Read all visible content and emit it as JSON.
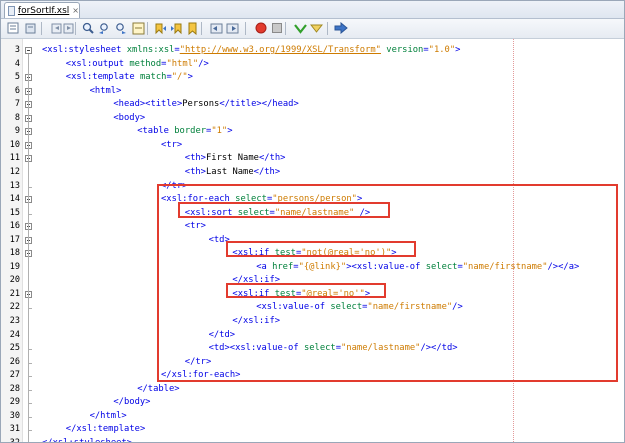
{
  "tab": {
    "title": "forSortIf.xsl",
    "close": "×"
  },
  "toolbar": {
    "buttons": [
      "source-view-icon",
      "history-icon",
      "back-icon",
      "forward-icon",
      "find-icon",
      "find-prev-icon",
      "find-next-icon",
      "toggle-highlight-icon",
      "prev-bookmark-icon",
      "next-bookmark-icon",
      "toggle-bookmark-icon",
      "shift-left-icon",
      "shift-right-icon",
      "record-macro-icon",
      "stop-macro-icon",
      "comment-icon",
      "uncomment-icon",
      "run-icon"
    ],
    "colors": {
      "record": "#e23b2e",
      "stop": "#8a8a8a",
      "check": "#33a02c",
      "arrow": "#3d74c6"
    }
  },
  "editor": {
    "highlight_color": "#e23b2e",
    "lines": [
      {
        "n": "3",
        "indent": 0,
        "segs": [
          [
            "pu",
            "<"
          ],
          [
            "ns",
            "xsl:stylesheet "
          ],
          [
            "at",
            "xmlns:xsl"
          ],
          [
            "pu",
            "="
          ],
          [
            "ul",
            "\"http://www.w3.org/1999/XSL/Transform\""
          ],
          [
            "tx",
            " "
          ],
          [
            "at",
            "version"
          ],
          [
            "pu",
            "="
          ],
          [
            "av",
            "\"1.0\""
          ],
          [
            "pu",
            ">"
          ]
        ]
      },
      {
        "n": "4",
        "indent": 1,
        "segs": [
          [
            "pu",
            "<"
          ],
          [
            "ns",
            "xsl:output "
          ],
          [
            "at",
            "method"
          ],
          [
            "pu",
            "="
          ],
          [
            "av",
            "\"html\""
          ],
          [
            "pu",
            "/>"
          ]
        ]
      },
      {
        "n": "5",
        "indent": 1,
        "segs": [
          [
            "pu",
            "<"
          ],
          [
            "ns",
            "xsl:template "
          ],
          [
            "at",
            "match"
          ],
          [
            "pu",
            "="
          ],
          [
            "av",
            "\"/\""
          ],
          [
            "pu",
            ">"
          ]
        ]
      },
      {
        "n": "6",
        "indent": 2,
        "segs": [
          [
            "pu",
            "<html>"
          ]
        ]
      },
      {
        "n": "7",
        "indent": 3,
        "segs": [
          [
            "pu",
            "<head><title>"
          ],
          [
            "tx",
            "Persons"
          ],
          [
            "pu",
            "</title></head>"
          ]
        ]
      },
      {
        "n": "8",
        "indent": 3,
        "segs": [
          [
            "pu",
            "<body>"
          ]
        ]
      },
      {
        "n": "9",
        "indent": 4,
        "segs": [
          [
            "pu",
            "<table "
          ],
          [
            "at",
            "border"
          ],
          [
            "pu",
            "="
          ],
          [
            "av",
            "\"1\""
          ],
          [
            "pu",
            ">"
          ]
        ]
      },
      {
        "n": "10",
        "indent": 5,
        "segs": [
          [
            "pu",
            "<tr>"
          ]
        ]
      },
      {
        "n": "11",
        "indent": 6,
        "segs": [
          [
            "pu",
            "<th>"
          ],
          [
            "tx",
            "First Name"
          ],
          [
            "pu",
            "</th>"
          ]
        ]
      },
      {
        "n": "12",
        "indent": 6,
        "segs": [
          [
            "pu",
            "<th>"
          ],
          [
            "tx",
            "Last Name"
          ],
          [
            "pu",
            "</th>"
          ]
        ]
      },
      {
        "n": "13",
        "indent": 5,
        "segs": [
          [
            "pu",
            "</tr>"
          ]
        ]
      },
      {
        "n": "14",
        "indent": 5,
        "segs": [
          [
            "pu",
            "<"
          ],
          [
            "ns",
            "xsl:for-each "
          ],
          [
            "at",
            "select"
          ],
          [
            "pu",
            "="
          ],
          [
            "av",
            "\"persons/person\""
          ],
          [
            "pu",
            ">"
          ]
        ]
      },
      {
        "n": "15",
        "indent": 6,
        "segs": [
          [
            "pu",
            "<"
          ],
          [
            "ns",
            "xsl:sort "
          ],
          [
            "at",
            "select"
          ],
          [
            "pu",
            "="
          ],
          [
            "av",
            "\"name/lastname\""
          ],
          [
            "tx",
            " "
          ],
          [
            "pu",
            "/>"
          ]
        ]
      },
      {
        "n": "16",
        "indent": 6,
        "segs": [
          [
            "pu",
            "<tr>"
          ]
        ]
      },
      {
        "n": "17",
        "indent": 7,
        "segs": [
          [
            "pu",
            "<td>"
          ]
        ]
      },
      {
        "n": "18",
        "indent": 8,
        "segs": [
          [
            "pu",
            "<"
          ],
          [
            "ns",
            "xsl:if "
          ],
          [
            "at",
            "test"
          ],
          [
            "pu",
            "="
          ],
          [
            "av",
            "\"not(@real='no')\""
          ],
          [
            "pu",
            ">"
          ]
        ]
      },
      {
        "n": "19",
        "indent": 9,
        "segs": [
          [
            "pu",
            "<a "
          ],
          [
            "at",
            "href"
          ],
          [
            "pu",
            "="
          ],
          [
            "av",
            "\"{@link}\""
          ],
          [
            "pu",
            "><"
          ],
          [
            "ns",
            "xsl:value-of "
          ],
          [
            "at",
            "select"
          ],
          [
            "pu",
            "="
          ],
          [
            "av",
            "\"name/firstname\""
          ],
          [
            "pu",
            "/></a>"
          ]
        ]
      },
      {
        "n": "20",
        "indent": 8,
        "segs": [
          [
            "pu",
            "</"
          ],
          [
            "ns",
            "xsl:if"
          ],
          [
            "pu",
            ">"
          ]
        ]
      },
      {
        "n": "21",
        "indent": 8,
        "segs": [
          [
            "pu",
            "<"
          ],
          [
            "ns",
            "xsl:if "
          ],
          [
            "at",
            "test"
          ],
          [
            "pu",
            "="
          ],
          [
            "av",
            "\"@real='no'\""
          ],
          [
            "pu",
            ">"
          ]
        ]
      },
      {
        "n": "22",
        "indent": 9,
        "segs": [
          [
            "pu",
            "<"
          ],
          [
            "ns",
            "xsl:value-of "
          ],
          [
            "at",
            "select"
          ],
          [
            "pu",
            "="
          ],
          [
            "av",
            "\"name/firstname\""
          ],
          [
            "pu",
            "/>"
          ]
        ]
      },
      {
        "n": "23",
        "indent": 8,
        "segs": [
          [
            "pu",
            "</"
          ],
          [
            "ns",
            "xsl:if"
          ],
          [
            "pu",
            ">"
          ]
        ]
      },
      {
        "n": "24",
        "indent": 7,
        "segs": [
          [
            "pu",
            "</td>"
          ]
        ]
      },
      {
        "n": "25",
        "indent": 7,
        "segs": [
          [
            "pu",
            "<td><"
          ],
          [
            "ns",
            "xsl:value-of "
          ],
          [
            "at",
            "select"
          ],
          [
            "pu",
            "="
          ],
          [
            "av",
            "\"name/lastname\""
          ],
          [
            "pu",
            "/></td>"
          ]
        ]
      },
      {
        "n": "26",
        "indent": 6,
        "segs": [
          [
            "pu",
            "</tr>"
          ]
        ]
      },
      {
        "n": "27",
        "indent": 5,
        "segs": [
          [
            "pu",
            "</"
          ],
          [
            "ns",
            "xsl:for-each"
          ],
          [
            "pu",
            ">"
          ]
        ]
      },
      {
        "n": "28",
        "indent": 4,
        "segs": [
          [
            "pu",
            "</table>"
          ]
        ]
      },
      {
        "n": "29",
        "indent": 3,
        "segs": [
          [
            "pu",
            "</body>"
          ]
        ]
      },
      {
        "n": "30",
        "indent": 2,
        "segs": [
          [
            "pu",
            "</html>"
          ]
        ]
      },
      {
        "n": "31",
        "indent": 1,
        "segs": [
          [
            "pu",
            "</"
          ],
          [
            "ns",
            "xsl:template"
          ],
          [
            "pu",
            ">"
          ]
        ]
      },
      {
        "n": "32",
        "indent": 0,
        "segs": [
          [
            "pu",
            "</"
          ],
          [
            "ns",
            "xsl:stylesheet"
          ],
          [
            "pu",
            ">"
          ]
        ]
      }
    ]
  }
}
